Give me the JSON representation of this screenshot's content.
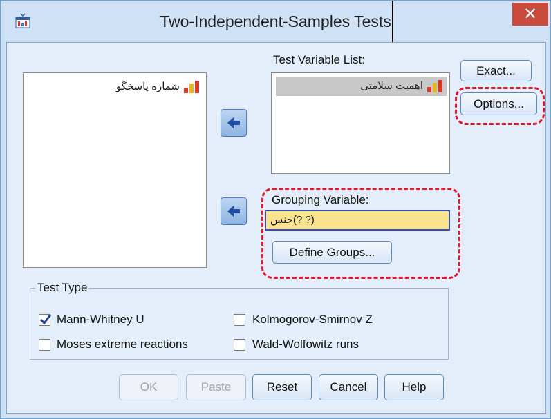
{
  "window": {
    "title": "Two-Independent-Samples Tests",
    "close_label": "✕",
    "app_icon": "spss-dialog-icon"
  },
  "source_list": {
    "items": [
      {
        "label": "شماره پاسخگو",
        "icon": "scale-variable-icon"
      }
    ]
  },
  "test_variable_list": {
    "label": "Test Variable List:",
    "items": [
      {
        "label": "اهمیت سلامتی",
        "icon": "scale-variable-icon",
        "selected": true
      }
    ]
  },
  "grouping": {
    "label": "Grouping Variable:",
    "value": "جنس(? ?)",
    "define_groups_label": "Define Groups..."
  },
  "side_buttons": {
    "exact_label": "Exact...",
    "options_label": "Options..."
  },
  "test_type": {
    "legend": "Test Type",
    "options": [
      {
        "label": "Mann-Whitney U",
        "checked": true
      },
      {
        "label": "Kolmogorov-Smirnov Z",
        "checked": false
      },
      {
        "label": "Moses extreme reactions",
        "checked": false
      },
      {
        "label": "Wald-Wolfowitz runs",
        "checked": false
      }
    ]
  },
  "footer": {
    "ok_label": "OK",
    "paste_label": "Paste",
    "reset_label": "Reset",
    "cancel_label": "Cancel",
    "help_label": "Help"
  },
  "colors": {
    "highlight_dash": "#e1192a",
    "grouping_field_bg": "#fae38f",
    "close_button": "#c84a3c",
    "dialog_bg": "#e4eefa"
  }
}
